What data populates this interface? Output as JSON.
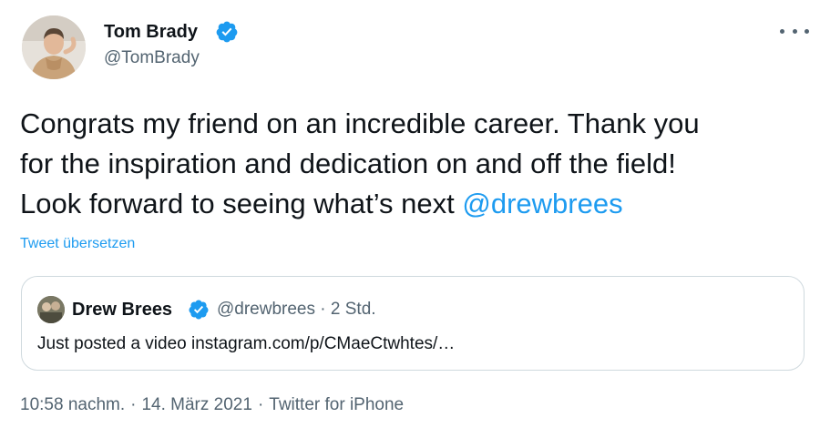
{
  "author": {
    "name": "Tom Brady",
    "handle": "@TomBrady",
    "verified": true
  },
  "tweet": {
    "text_lines": [
      "Congrats my friend on an incredible career. Thank you",
      "for the inspiration and dedication on and off the field!",
      "Look forward to seeing what’s next "
    ],
    "mention": "@drewbrees",
    "translate_label": "Tweet übersetzen"
  },
  "quoted_tweet": {
    "name": "Drew Brees",
    "handle": "@drewbrees",
    "separator": "·",
    "time": "2 Std.",
    "text": "Just posted a video instagram.com/p/CMaeCtwhtes/…"
  },
  "footer": {
    "time": "10:58 nachm.",
    "date": "14. März 2021",
    "source": "Twitter for iPhone",
    "separator": "·"
  },
  "colors": {
    "link": "#1d9bf0",
    "secondary_text": "#536471",
    "border": "#cfd9de"
  },
  "icons": [
    "verified-badge-icon",
    "more-options-icon"
  ]
}
